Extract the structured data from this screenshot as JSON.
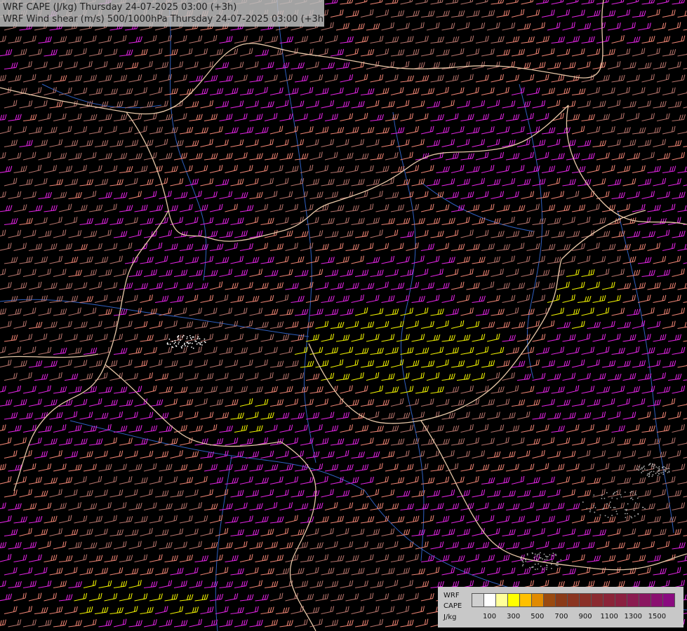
{
  "titles": {
    "line1": "WRF CAPE (J/kg) Thursday 24-07-2025 03:00 (+3h)",
    "line2": "WRF Wind shear (m/s) 500/1000hPa Thursday 24-07-2025 03:00 (+3h)"
  },
  "legend": {
    "label_line1": "WRF",
    "label_line2": "CAPE",
    "label_line3": "J/kg",
    "colors": [
      "#cfcfcf",
      "#ffffff",
      "#ffff99",
      "#ffff00",
      "#ffc000",
      "#e08a00",
      "#9a4a10",
      "#8a3a18",
      "#8a3420",
      "#8a3028",
      "#8a2a30",
      "#8a2438",
      "#8a2040",
      "#8a1c50",
      "#8a1660",
      "#8a1070",
      "#8a0a80"
    ],
    "ticks": [
      "100",
      "300",
      "500",
      "700",
      "900",
      "1100",
      "1300",
      "1500"
    ]
  },
  "map_colors": {
    "background": "#000000",
    "barb_light": "#b07068",
    "barb_salmon": "#e88070",
    "barb_magenta": "#dd22dd",
    "barb_yellow": "#eeee00",
    "border": "#e8c8a8",
    "river": "#3060c0"
  }
}
